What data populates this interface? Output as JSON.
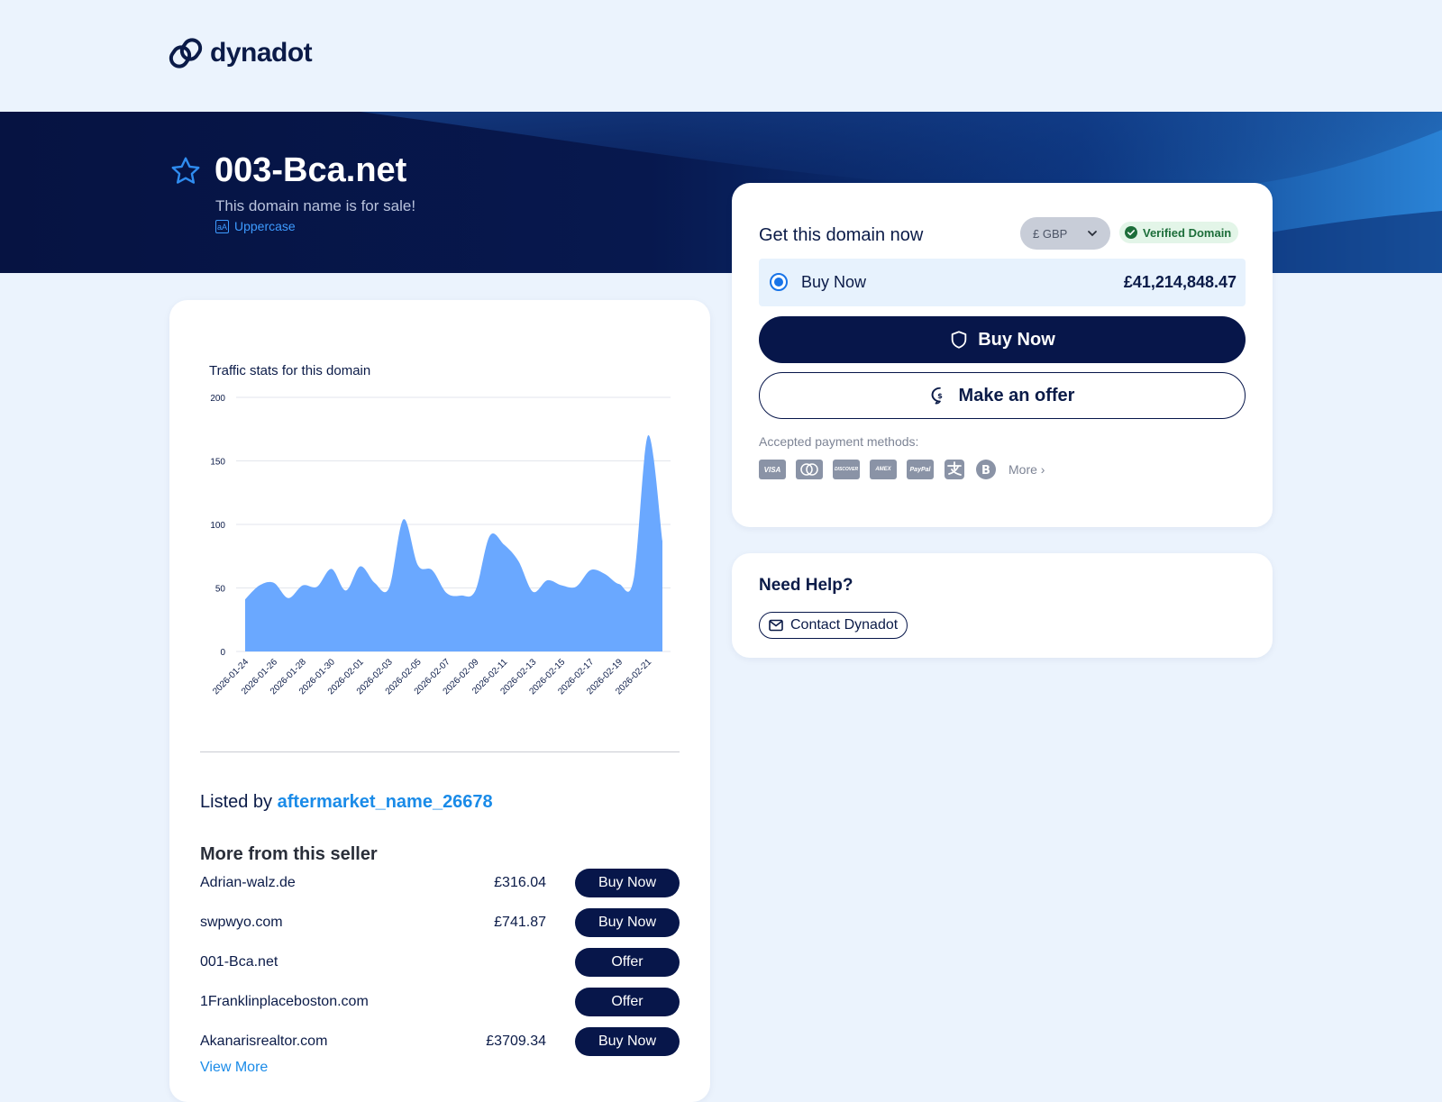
{
  "brand": {
    "name": "dynadot"
  },
  "hero": {
    "domain": "003-Bca.net",
    "subtitle": "This domain name is for sale!",
    "case_toggle": "Uppercase"
  },
  "traffic": {
    "title": "Traffic stats for this domain"
  },
  "chart_data": {
    "type": "area",
    "title": "Traffic stats for this domain",
    "xlabel": "",
    "ylabel": "",
    "ylim": [
      0,
      200
    ],
    "yticks": [
      0,
      50,
      100,
      150,
      200
    ],
    "xtick_labels": [
      "2026-01-24",
      "2026-01-26",
      "2026-01-28",
      "2026-01-30",
      "2026-02-01",
      "2026-02-03",
      "2026-02-05",
      "2026-02-07",
      "2026-02-09",
      "2026-02-11",
      "2026-02-13",
      "2026-02-15",
      "2026-02-17",
      "2026-02-19",
      "2026-02-21"
    ],
    "x": [
      "2026-01-24",
      "2026-01-25",
      "2026-01-26",
      "2026-01-27",
      "2026-01-28",
      "2026-01-29",
      "2026-01-30",
      "2026-01-31",
      "2026-02-01",
      "2026-02-02",
      "2026-02-03",
      "2026-02-04",
      "2026-02-05",
      "2026-02-06",
      "2026-02-07",
      "2026-02-08",
      "2026-02-09",
      "2026-02-10",
      "2026-02-11",
      "2026-02-12",
      "2026-02-13",
      "2026-02-14",
      "2026-02-15",
      "2026-02-16",
      "2026-02-17",
      "2026-02-18",
      "2026-02-19",
      "2026-02-20",
      "2026-02-21",
      "2026-02-22"
    ],
    "values": [
      41,
      52,
      54,
      42,
      52,
      51,
      65,
      48,
      67,
      54,
      50,
      104,
      68,
      64,
      46,
      44,
      48,
      91,
      84,
      71,
      47,
      56,
      52,
      51,
      64,
      61,
      53,
      57,
      170,
      87
    ],
    "color": "#6aa8ff"
  },
  "listing": {
    "listed_by": "Listed by",
    "seller": "aftermarket_name_26678",
    "more_title": "More from this seller",
    "rows": [
      {
        "domain": "Adrian-walz.de",
        "price": "£316.04",
        "action": "Buy Now"
      },
      {
        "domain": "swpwyo.com",
        "price": "£741.87",
        "action": "Buy Now"
      },
      {
        "domain": "001-Bca.net",
        "price": "",
        "action": "Offer"
      },
      {
        "domain": "1Franklinplaceboston.com",
        "price": "",
        "action": "Offer"
      },
      {
        "domain": "Akanarisrealtor.com",
        "price": "£3709.34",
        "action": "Buy Now"
      }
    ],
    "view_more": "View More"
  },
  "purchase": {
    "heading": "Get this domain now",
    "currency": "£ GBP",
    "verified": "Verified Domain",
    "option_label": "Buy Now",
    "option_price": "£41,214,848.47",
    "buy_button": "Buy Now",
    "offer_button": "Make an offer",
    "payment_label": "Accepted payment methods:",
    "payment_icons": [
      "visa-icon",
      "mastercard-icon",
      "discover-icon",
      "amex-icon",
      "paypal-icon",
      "alipay-icon",
      "bitcoin-icon"
    ],
    "payment_text": {
      "visa": "VISA",
      "paypal": "PayPal",
      "discover": "DISCOVER",
      "amex": "AMEX"
    },
    "more": "More"
  },
  "help": {
    "title": "Need Help?",
    "contact": "Contact Dynadot"
  },
  "colors": {
    "navy": "#07164a",
    "accent": "#1a8be8",
    "chart_fill": "#6aa8ff",
    "page_bg": "#ebf3fd"
  }
}
